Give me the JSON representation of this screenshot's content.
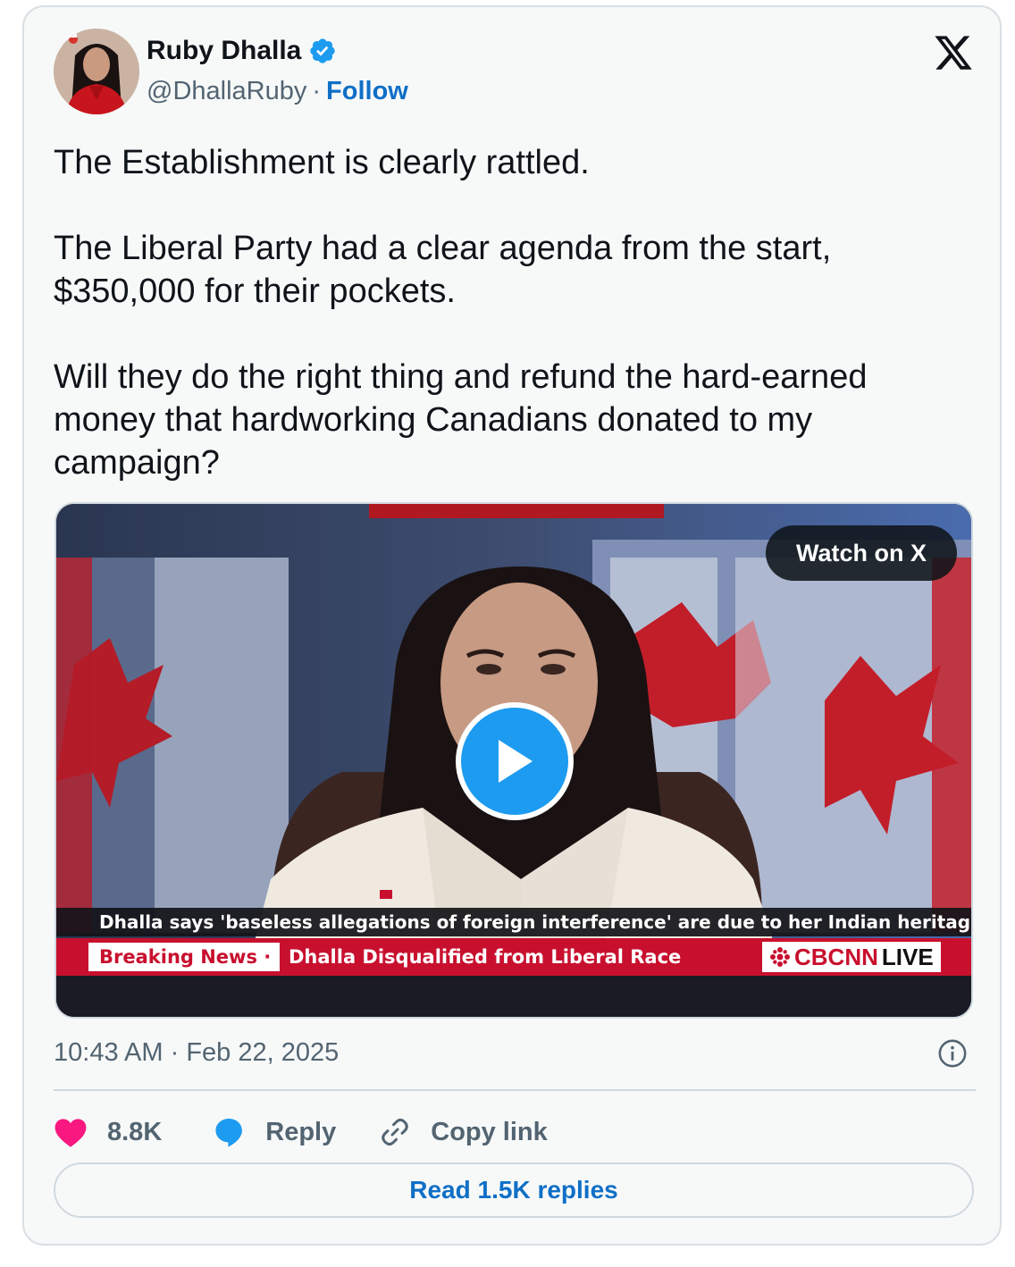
{
  "author": {
    "name": "Ruby Dhalla",
    "handle": "@DhallaRuby",
    "separator": "·",
    "follow_label": "Follow"
  },
  "tweet": {
    "text": "The Establishment is clearly rattled.\n\nThe Liberal Party had a clear agenda from the start,\n$350,000 for their pockets.\n\nWill they do the right thing and refund the hard-earned\nmoney that hardworking Canadians donated to my\ncampaign?"
  },
  "media": {
    "watch_label": "Watch on X",
    "chyron_top": "Dhalla says 'baseless allegations of foreign interference' are due to her Indian heritage",
    "breaking_label": "Breaking News",
    "breaking_sep": "·",
    "headline": "Dhalla Disqualified from Liberal Race",
    "network": "CBCNN",
    "network_live": "LIVE"
  },
  "meta": {
    "time": "10:43 AM",
    "separator": "·",
    "date": "Feb 22, 2025"
  },
  "actions": {
    "likes": "8.8K",
    "reply_label": "Reply",
    "copy_label": "Copy link"
  },
  "read_replies_label": "Read 1.5K replies",
  "colors": {
    "accent": "#1d9bf0",
    "link": "#0f6fc6",
    "like": "#f91880",
    "muted": "#536471",
    "card_bg": "#f7f9f9",
    "news_red": "#c8102e"
  }
}
